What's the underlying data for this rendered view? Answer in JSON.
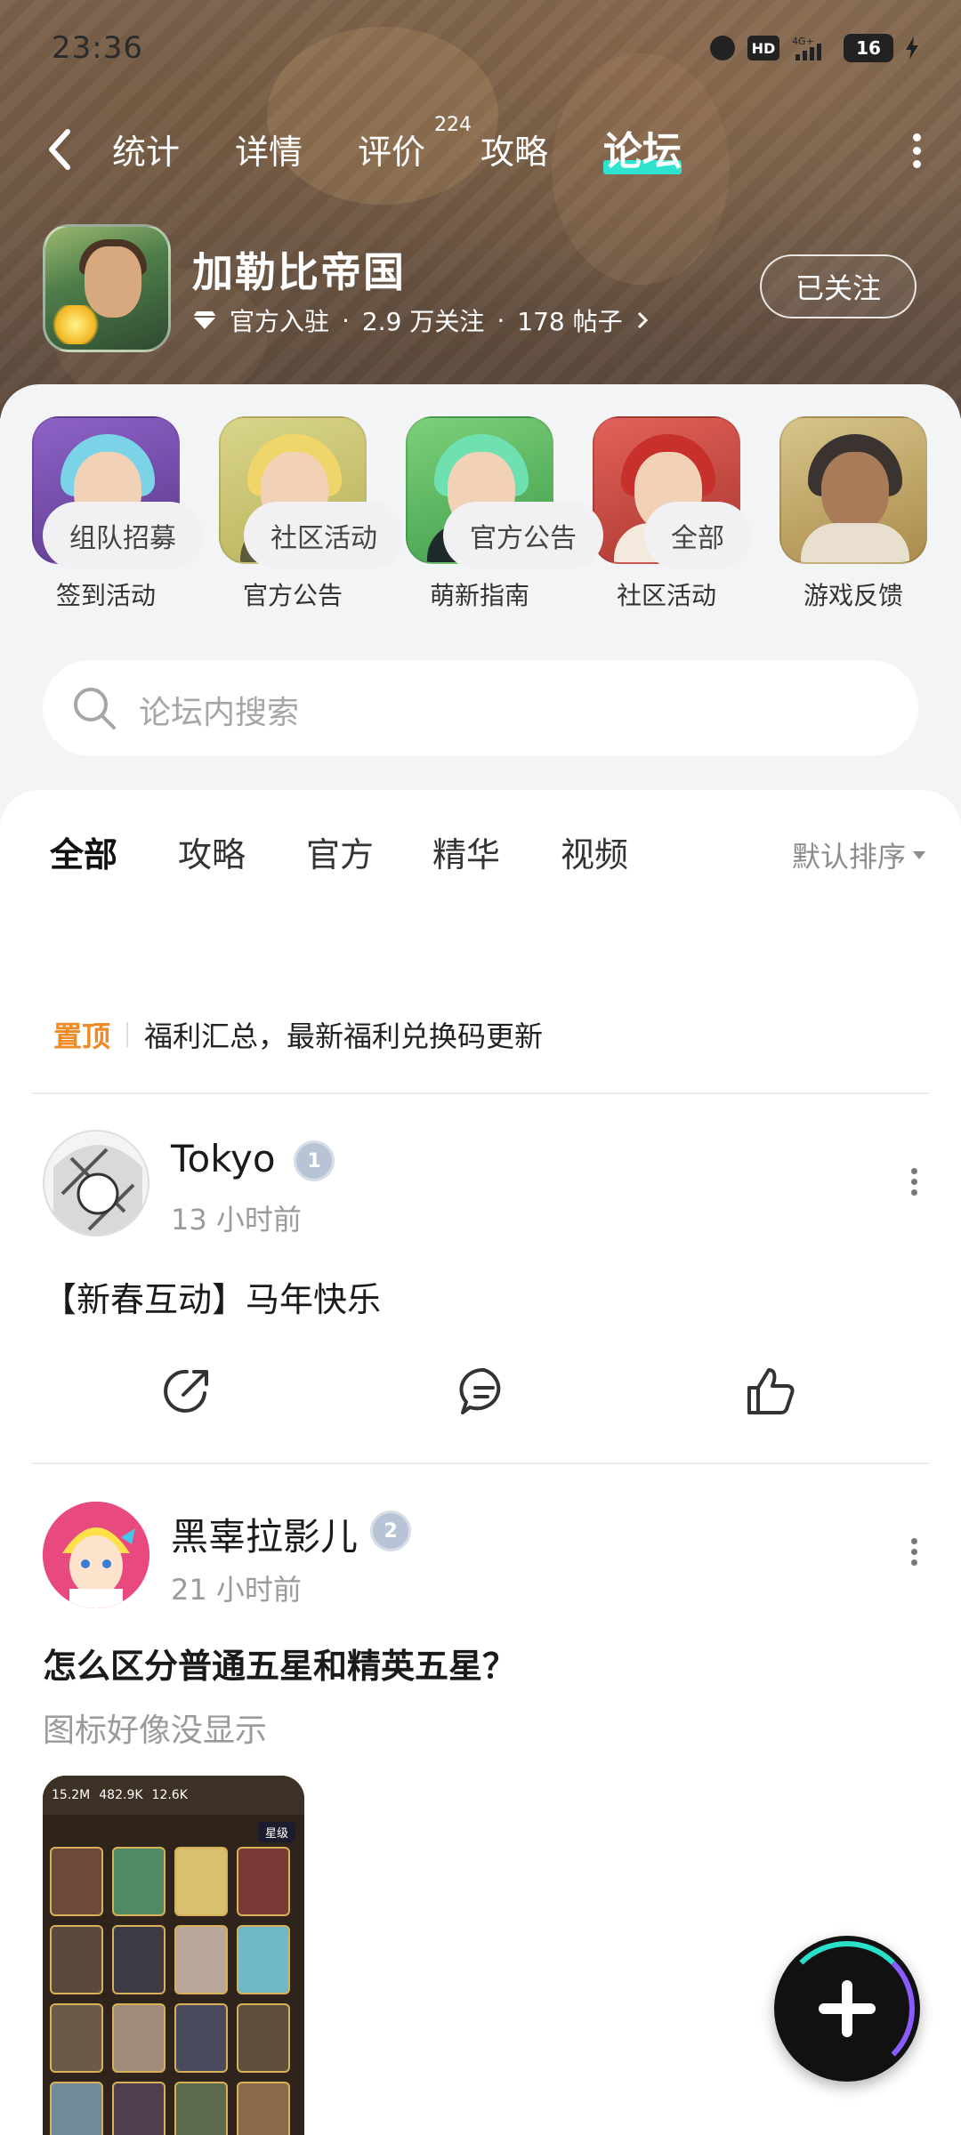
{
  "status_bar": {
    "time": "23:36",
    "hd": "HD",
    "signal": "4G+",
    "battery": "16"
  },
  "nav": {
    "tabs": [
      {
        "label": "统计"
      },
      {
        "label": "详情"
      },
      {
        "label": "评价",
        "badge": "224"
      },
      {
        "label": "攻略"
      },
      {
        "label": "论坛",
        "active": true
      }
    ]
  },
  "game": {
    "title": "加勒比帝国",
    "official": "官方入驻",
    "followers": "2.9 万关注",
    "posts": "178 帖子",
    "follow_label": "已关注"
  },
  "shortcuts": [
    {
      "label": "签到活动",
      "icon": "check-in-icon"
    },
    {
      "label": "官方公告",
      "icon": "announcement-icon"
    },
    {
      "label": "萌新指南",
      "icon": "guide-icon"
    },
    {
      "label": "社区活动",
      "icon": "community-icon"
    },
    {
      "label": "游戏反馈",
      "icon": "feedback-icon"
    }
  ],
  "search": {
    "placeholder": "论坛内搜索"
  },
  "feed_tabs": [
    {
      "label": "全部",
      "active": true
    },
    {
      "label": "攻略"
    },
    {
      "label": "官方"
    },
    {
      "label": "精华"
    },
    {
      "label": "视频"
    }
  ],
  "sort": {
    "label": "默认排序"
  },
  "chips": [
    {
      "label": "组队招募"
    },
    {
      "label": "社区活动"
    },
    {
      "label": "官方公告"
    },
    {
      "label": "全部"
    }
  ],
  "pinned": {
    "tag": "置顶",
    "text": "福利汇总，最新福利兑换码更新"
  },
  "posts": [
    {
      "user": "Tokyo",
      "level": "1",
      "time": "13 小时前",
      "title": "【新春互动】马年快乐"
    },
    {
      "user": "黑辜拉影儿",
      "level": "2",
      "time": "21 小时前",
      "title": "怎么区分普通五星和精英五星？",
      "desc": "图标好像没显示",
      "screenshot": {
        "stats": [
          "15.2M",
          "482.9K",
          "12.6K"
        ],
        "filter": "星级"
      }
    }
  ],
  "colors": {
    "accent": "#2fe3cf",
    "pinned": "#f08a24"
  }
}
